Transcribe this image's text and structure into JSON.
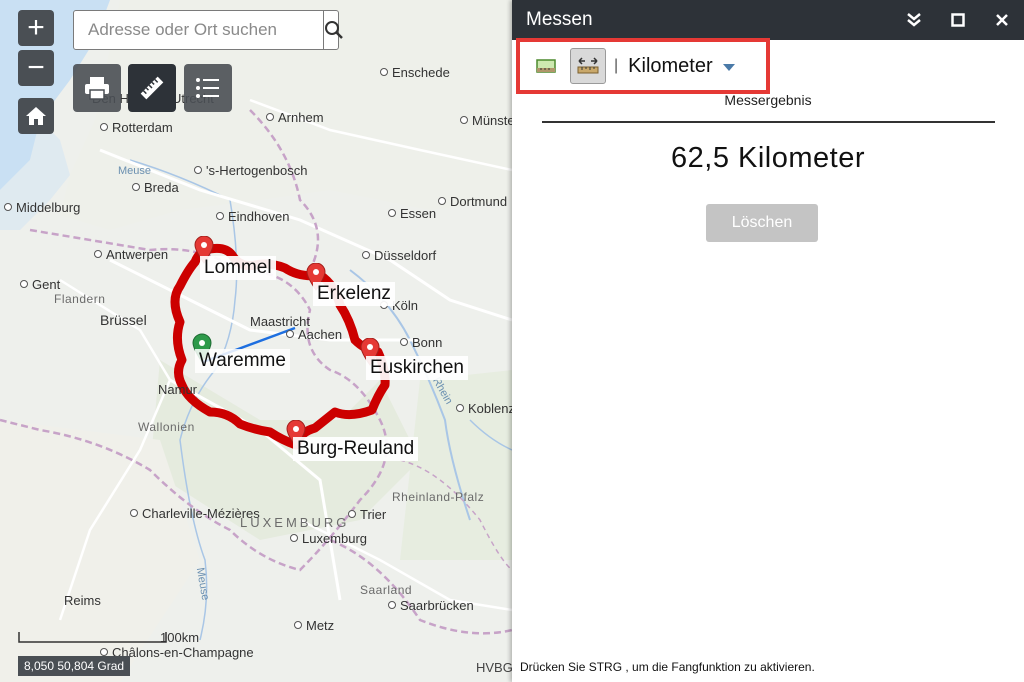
{
  "map": {
    "search": {
      "placeholder": "Adresse oder Ort suchen"
    },
    "places": [
      {
        "name": "Enschede",
        "dot": true
      },
      {
        "name": "Arnhem",
        "dot": true
      },
      {
        "name": "Münster",
        "dot": true
      },
      {
        "name": "Rotterdam",
        "dot": true
      },
      {
        "name": "'s-Hertogenbosch",
        "dot": true
      },
      {
        "name": "Breda",
        "dot": true
      },
      {
        "name": "Dortmund",
        "dot": true
      },
      {
        "name": "Middelburg",
        "dot": true
      },
      {
        "name": "Eindhoven",
        "dot": true
      },
      {
        "name": "Essen",
        "dot": true
      },
      {
        "name": "Antwerpen",
        "dot": true
      },
      {
        "name": "Düsseldorf",
        "dot": true
      },
      {
        "name": "Gent",
        "dot": true
      },
      {
        "name": "Köln",
        "dot": true
      },
      {
        "name": "Brüssel",
        "dot": true
      },
      {
        "name": "Maastricht",
        "dot": true
      },
      {
        "name": "Aachen",
        "dot": true
      },
      {
        "name": "Bonn",
        "dot": true
      },
      {
        "name": "Namur",
        "dot": true
      },
      {
        "name": "Koblenz",
        "dot": true
      },
      {
        "name": "Charleville-Mézières",
        "dot": true
      },
      {
        "name": "Trier",
        "dot": true
      },
      {
        "name": "Luxemburg",
        "dot": true
      },
      {
        "name": "Reims",
        "dot": true
      },
      {
        "name": "Saarbrücken",
        "dot": true
      },
      {
        "name": "Metz",
        "dot": true
      },
      {
        "name": "Châlons-en-Champagne",
        "dot": true
      },
      {
        "name": "Den Haag",
        "dot": false
      },
      {
        "name": "Utrecht",
        "dot": true
      }
    ],
    "regions": [
      "Flandern",
      "Wallonien",
      "Rheinland-Pfalz",
      "LUXEMBURG",
      "Saarland"
    ],
    "water": [
      "Meuse",
      "Rhein",
      "Meuse"
    ],
    "stops": [
      "Lommel",
      "Erkelenz",
      "Waremme",
      "Euskirchen",
      "Burg-Reuland"
    ],
    "scale_label": "100km",
    "coords": "8,050 50,804 Grad",
    "attribution_partial": "HVBG",
    "colors": {
      "route": "#cc0000",
      "measure_line": "#1e6fe0",
      "marker_red": "#e53935",
      "marker_green": "#2e9a4a"
    },
    "controls": [
      "zoom-in",
      "zoom-out",
      "home",
      "print",
      "measure",
      "legend"
    ]
  },
  "panel": {
    "title": "Messen",
    "unit": "Kilometer",
    "result_label": "Messergebnis",
    "result_value": "62,5 Kilometer",
    "clear_label": "Löschen",
    "hint": "Drücken Sie STRG , um die Fangfunktion zu aktivieren."
  }
}
